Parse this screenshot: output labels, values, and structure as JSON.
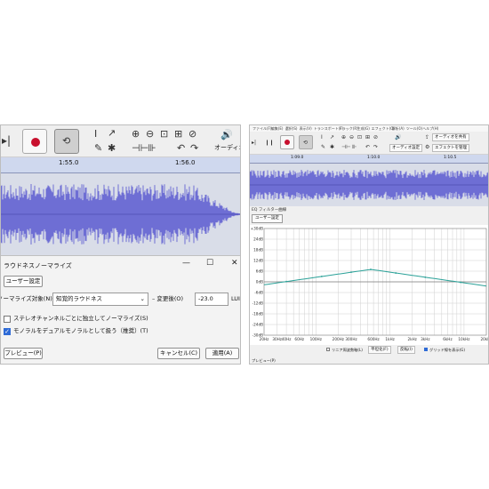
{
  "left": {
    "timeline": {
      "ticks": [
        "1:55.0",
        "1:56.0"
      ]
    },
    "toolbar": {
      "audio_settings_label": "オーディオ設"
    },
    "dialog": {
      "title": "ラウドネスノーマライズ",
      "preset_button": "ユーザー設定",
      "normalize_target_label": "ノーマライズ対象(N)",
      "normalize_target_value": "知覚的ラウドネス",
      "change_label": "変更後(O)",
      "change_value": "-23.0",
      "change_unit": "LUI",
      "stereo_independent_label": "ステレオチャンネルごとに独立してノーマライズ(S)",
      "stereo_independent_checked": false,
      "mono_as_dual_label": "モノラルをデュアルモノラルとして扱う（推奨）(T)",
      "mono_as_dual_checked": true,
      "preview_button": "プレビュー(P)",
      "cancel_button": "キャンセル(C)",
      "apply_button": "適用(A)"
    }
  },
  "right": {
    "menu": [
      "ファイル(F)",
      "編集(E)",
      "選択(S)",
      "表示(V)",
      "トランスポート(T)",
      "トラック(R)",
      "生成(G)",
      "エフェクト(C)",
      "解析(A)",
      "ツール(O)",
      "ヘルプ(H)"
    ],
    "toolbar": {
      "audio_setup": "オーディオ設定",
      "share_audio": "オーディオを共有",
      "effects_button": "エフェクトを管理"
    },
    "timeline": {
      "ticks": [
        "1:09.0",
        "1:10.0",
        "1:10.5"
      ]
    },
    "eq": {
      "title": "EQ フィルター曲線",
      "preset_button": "ユーザー設定",
      "y_labels": [
        "+30dB",
        "24dB",
        "18dB",
        "12dB",
        "6dB",
        "0dB",
        "-6dB",
        "-12dB",
        "-18dB",
        "-24dB",
        "-30dB"
      ],
      "x_labels": [
        "20Hz",
        "30Hz",
        "40Hz",
        "60Hz",
        "100Hz",
        "200Hz",
        "300Hz",
        "600Hz",
        "1kHz",
        "2kHz",
        "3kHz",
        "6kHz",
        "10kHz",
        "20kHz"
      ],
      "curve_color": "#2aa198",
      "options": {
        "linear_freq_label": "リニア周波数軸(L)",
        "linear_freq_checked": false,
        "flatten_label": "平坦化(F)",
        "invert_label": "反転(I)",
        "grid_label": "グリッド線を表示(G)",
        "grid_checked": true
      },
      "preview_button": "プレビュー(P)"
    }
  },
  "colors": {
    "waveform": "#6e6ed4",
    "waveform_bg": "#d9dde8",
    "timeline_bg": "#cfd8ee",
    "record": "#c8102e",
    "eq_curve": "#2aa198"
  }
}
